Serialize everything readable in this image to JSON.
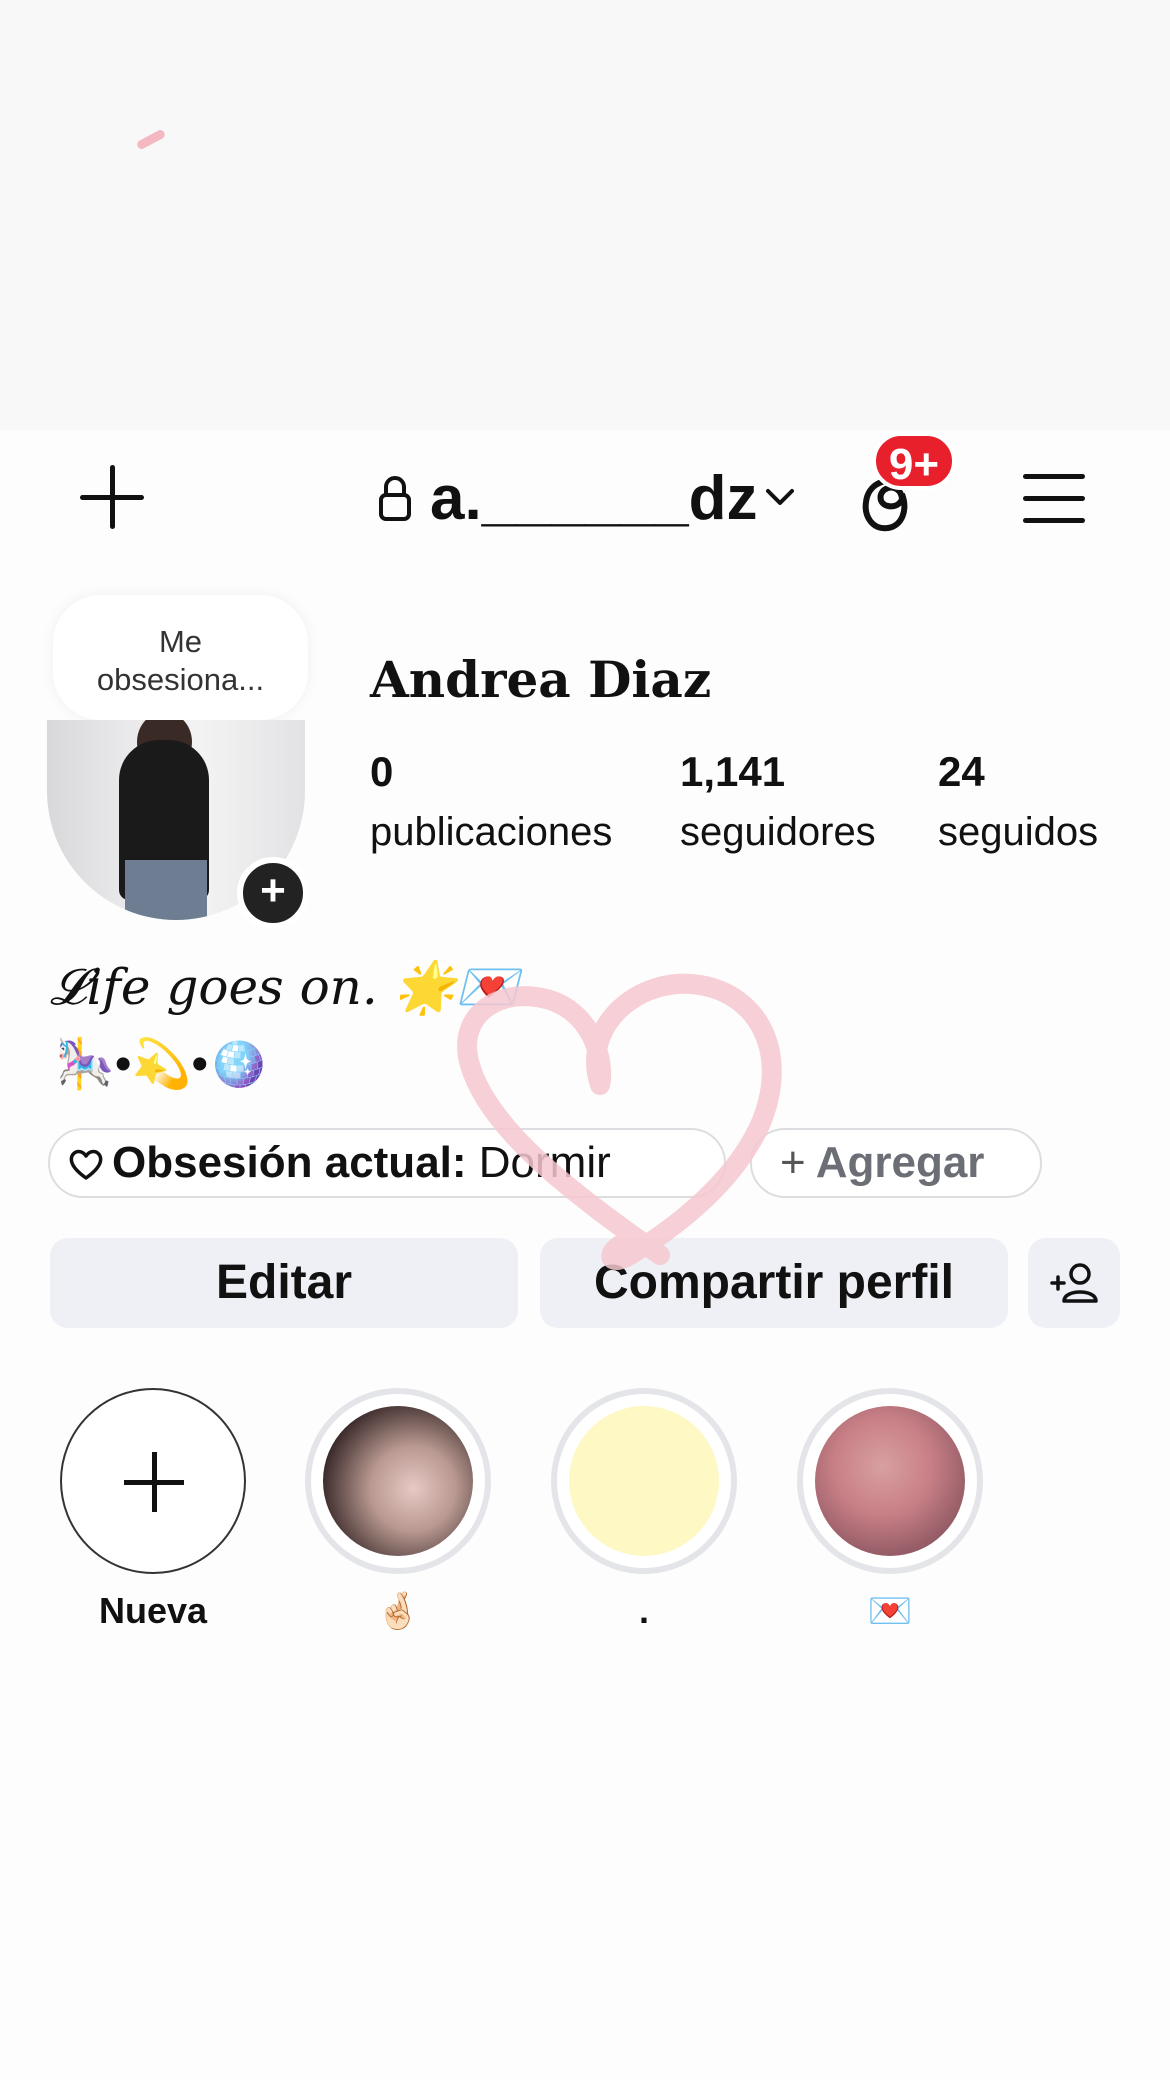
{
  "header": {
    "username": "a.______dz",
    "badge": "9+",
    "icons": [
      "plus-icon",
      "lock-icon",
      "chevron-down-icon",
      "threads-icon",
      "menu-icon"
    ]
  },
  "profile": {
    "note": "Me obsesiona...",
    "name": "Andrea Diaz",
    "stats": [
      {
        "value": "0",
        "label": "publicaciones"
      },
      {
        "value": "1,141",
        "label": "seguidores"
      },
      {
        "value": "24",
        "label": "seguidos"
      }
    ]
  },
  "bio": {
    "line1": "𝓛ife goes on. 🌟💌",
    "line2": "🎠•💫•🪩"
  },
  "chips": {
    "obsession_label": "Obsesión actual:",
    "obsession_value": "Dormir",
    "add_label": "Agregar"
  },
  "buttons": {
    "edit": "Editar",
    "share": "Compartir perfil"
  },
  "highlights": [
    {
      "label": "Nueva"
    },
    {
      "label": "🤞🏻"
    },
    {
      "label": "."
    },
    {
      "label": "💌"
    }
  ],
  "colors": {
    "badge": "#e8202c",
    "button_bg": "#eef0f6",
    "heart_stroke": "#f6c7cf",
    "highlight_yellow": "#fdf8c4"
  }
}
